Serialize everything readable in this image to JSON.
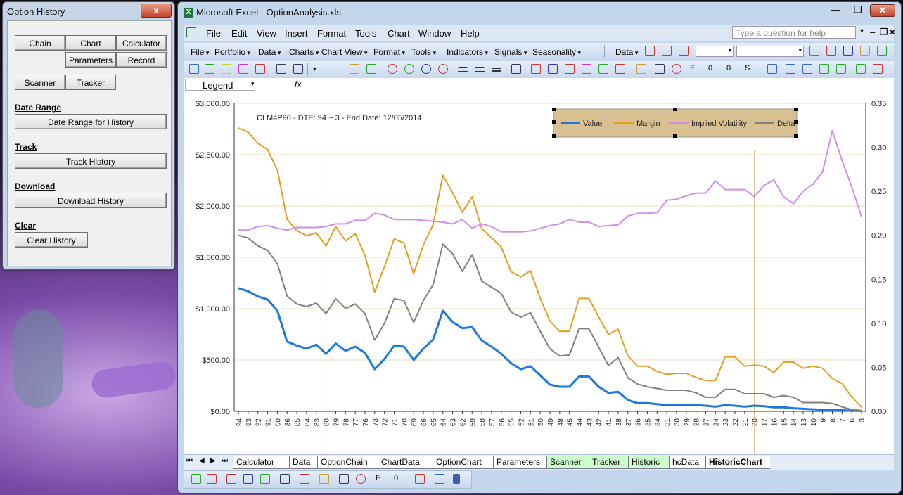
{
  "option_history": {
    "title": "Option History",
    "close_label": "x",
    "buttons": {
      "chain": "Chain",
      "chart": "Chart",
      "calculator": "Calculator",
      "parameters": "Parameters",
      "record": "Record",
      "scanner": "Scanner",
      "tracker": "Tracker"
    },
    "date_range": {
      "heading": "Date Range",
      "button": "Date Range for History"
    },
    "track": {
      "heading": "Track",
      "button": "Track History"
    },
    "download": {
      "heading": "Download",
      "button": "Download History"
    },
    "clear": {
      "heading": "Clear",
      "button": "Clear History"
    }
  },
  "excel": {
    "title": "Microsoft Excel - OptionAnalysis.xls",
    "menus": [
      "File",
      "Edit",
      "View",
      "Insert",
      "Format",
      "Tools",
      "Chart",
      "Window",
      "Help"
    ],
    "ask_placeholder": "Type a question for help",
    "toolbar_menus": [
      "File",
      "Portfolio",
      "Data",
      "Charts",
      "Chart View",
      "Format",
      "Tools",
      "Indicators",
      "Signals",
      "Seasonality"
    ],
    "data_menu": "Data",
    "name_box": "Legend",
    "fx": "fx",
    "sheet_tabs": [
      {
        "label": "Calculator",
        "color": "#ffffff"
      },
      {
        "label": "Data",
        "color": "#ffffff"
      },
      {
        "label": "OptionChain",
        "color": "#ffffff"
      },
      {
        "label": "ChartData",
        "color": "#ffffff"
      },
      {
        "label": "OptionChart",
        "color": "#ffffff"
      },
      {
        "label": "Parameters",
        "color": "#ffffff"
      },
      {
        "label": "Scanner",
        "color": "#ccffcc"
      },
      {
        "label": "Tracker",
        "color": "#ccffcc"
      },
      {
        "label": "Historic",
        "color": "#ccffcc"
      },
      {
        "label": "hcData",
        "color": "#ffffff"
      },
      {
        "label": "HistoricChart",
        "color": "#ffffff",
        "active": true
      }
    ]
  },
  "chart_data": {
    "type": "line",
    "title": "",
    "annotation": "CLM4P90  -  DTE: 94 ~ 3  -  End Date: 12/05/2014",
    "x": [
      "94",
      "93",
      "92",
      "91",
      "90",
      "86",
      "85",
      "84",
      "83",
      "80",
      "79",
      "78",
      "77",
      "76",
      "73",
      "72",
      "71",
      "70",
      "69",
      "66",
      "65",
      "64",
      "63",
      "62",
      "59",
      "58",
      "57",
      "56",
      "55",
      "52",
      "51",
      "50",
      "49",
      "48",
      "45",
      "44",
      "43",
      "42",
      "41",
      "38",
      "37",
      "36",
      "35",
      "34",
      "31",
      "30",
      "29",
      "28",
      "27",
      "24",
      "23",
      "22",
      "21",
      "20",
      "17",
      "16",
      "15",
      "14",
      "13",
      "10",
      "9",
      "8",
      "7",
      "6",
      "3"
    ],
    "y_left": {
      "min": 0,
      "max": 3000,
      "ticks": [
        "$0.00",
        "$500.00",
        "$1,000.00",
        "$1,500.00",
        "$2,000.00",
        "$2,500.00",
        "$3,000.00"
      ]
    },
    "y_right": {
      "min": 0,
      "max": 0.35,
      "ticks": [
        "0.00",
        "0.05",
        "0.10",
        "0.15",
        "0.20",
        "0.25",
        "0.30",
        "0.35"
      ]
    },
    "vertical_markers": [
      "80",
      "20"
    ],
    "legend_position": "top-right",
    "series": [
      {
        "name": "Value",
        "axis": "left",
        "color": "#1e78dc",
        "values": [
          1200,
          1170,
          1120,
          1090,
          980,
          680,
          640,
          610,
          650,
          560,
          660,
          590,
          630,
          570,
          410,
          510,
          640,
          630,
          500,
          610,
          700,
          980,
          870,
          810,
          820,
          690,
          630,
          560,
          470,
          410,
          440,
          350,
          260,
          240,
          240,
          340,
          340,
          240,
          180,
          190,
          110,
          80,
          80,
          70,
          60,
          60,
          60,
          60,
          55,
          45,
          60,
          55,
          45,
          55,
          50,
          40,
          40,
          30,
          25,
          20,
          15,
          15,
          10,
          5,
          5
        ]
      },
      {
        "name": "Margin",
        "axis": "left",
        "color": "#e0a020",
        "values": [
          2760,
          2720,
          2610,
          2550,
          2350,
          1870,
          1760,
          1710,
          1740,
          1610,
          1800,
          1660,
          1730,
          1520,
          1160,
          1410,
          1680,
          1640,
          1340,
          1620,
          1820,
          2300,
          2130,
          1940,
          2090,
          1780,
          1690,
          1600,
          1360,
          1310,
          1370,
          1100,
          880,
          780,
          780,
          1100,
          1100,
          920,
          750,
          800,
          540,
          440,
          440,
          390,
          360,
          370,
          370,
          330,
          300,
          300,
          530,
          530,
          440,
          450,
          440,
          380,
          480,
          480,
          420,
          440,
          420,
          320,
          270,
          140,
          40
        ]
      },
      {
        "name": "Implied Volatility",
        "axis": "right",
        "color": "#d08ee8",
        "values": [
          0.206,
          0.206,
          0.21,
          0.211,
          0.208,
          0.206,
          0.209,
          0.209,
          0.209,
          0.21,
          0.213,
          0.213,
          0.217,
          0.217,
          0.225,
          0.223,
          0.218,
          0.218,
          0.218,
          0.217,
          0.216,
          0.215,
          0.213,
          0.218,
          0.208,
          0.213,
          0.21,
          0.204,
          0.204,
          0.204,
          0.205,
          0.208,
          0.211,
          0.213,
          0.218,
          0.215,
          0.215,
          0.21,
          0.211,
          0.212,
          0.222,
          0.225,
          0.225,
          0.226,
          0.24,
          0.241,
          0.245,
          0.248,
          0.248,
          0.262,
          0.252,
          0.252,
          0.252,
          0.244,
          0.257,
          0.263,
          0.244,
          0.236,
          0.25,
          0.258,
          0.272,
          0.319,
          0.285,
          0.255,
          0.221
        ]
      },
      {
        "name": "Delta",
        "axis": "right",
        "color": "#808080",
        "values": [
          0.2,
          0.197,
          0.188,
          0.183,
          0.168,
          0.131,
          0.122,
          0.119,
          0.123,
          0.111,
          0.128,
          0.117,
          0.122,
          0.111,
          0.081,
          0.1,
          0.128,
          0.126,
          0.101,
          0.126,
          0.144,
          0.19,
          0.179,
          0.159,
          0.178,
          0.148,
          0.141,
          0.134,
          0.113,
          0.107,
          0.112,
          0.091,
          0.071,
          0.063,
          0.064,
          0.094,
          0.094,
          0.073,
          0.052,
          0.061,
          0.038,
          0.031,
          0.028,
          0.026,
          0.024,
          0.024,
          0.024,
          0.021,
          0.016,
          0.016,
          0.025,
          0.025,
          0.02,
          0.02,
          0.02,
          0.016,
          0.018,
          0.016,
          0.01,
          0.01,
          0.01,
          0.009,
          0.005,
          0.002,
          0.001
        ]
      }
    ]
  }
}
